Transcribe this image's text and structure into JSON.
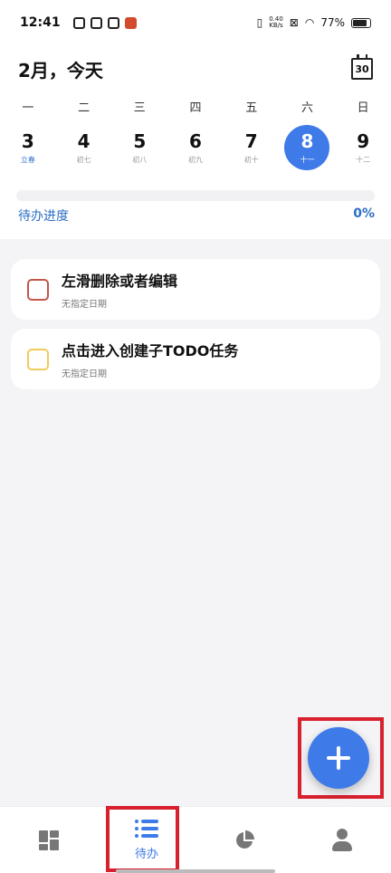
{
  "status_bar": {
    "time": "12:41",
    "net_speed_value": "0.40",
    "net_speed_unit": "KB/s",
    "battery": "77%"
  },
  "header": {
    "title": "2月，今天",
    "calendar_icon_text": "30"
  },
  "week": [
    {
      "weekday": "一",
      "date": "3",
      "lunar": "立春",
      "festival": true,
      "selected": false
    },
    {
      "weekday": "二",
      "date": "4",
      "lunar": "初七",
      "festival": false,
      "selected": false
    },
    {
      "weekday": "三",
      "date": "5",
      "lunar": "初八",
      "festival": false,
      "selected": false
    },
    {
      "weekday": "四",
      "date": "6",
      "lunar": "初九",
      "festival": false,
      "selected": false
    },
    {
      "weekday": "五",
      "date": "7",
      "lunar": "初十",
      "festival": false,
      "selected": false
    },
    {
      "weekday": "六",
      "date": "8",
      "lunar": "十一",
      "festival": false,
      "selected": true
    },
    {
      "weekday": "日",
      "date": "9",
      "lunar": "十二",
      "festival": false,
      "selected": false
    }
  ],
  "progress": {
    "label": "待办进度",
    "percent_text": "0%",
    "value": 0
  },
  "tasks": [
    {
      "title": "左滑删除或者编辑",
      "date": "无指定日期",
      "color": "#c2564b"
    },
    {
      "title": "点击进入创建子TODO任务",
      "date": "无指定日期",
      "color": "#efcc5a"
    }
  ],
  "bottom_nav": {
    "active_label": "待办",
    "accent_color": "#3e7ae8"
  },
  "colors": {
    "accent": "#3e7ae8",
    "highlight_box": "#d8202e"
  }
}
